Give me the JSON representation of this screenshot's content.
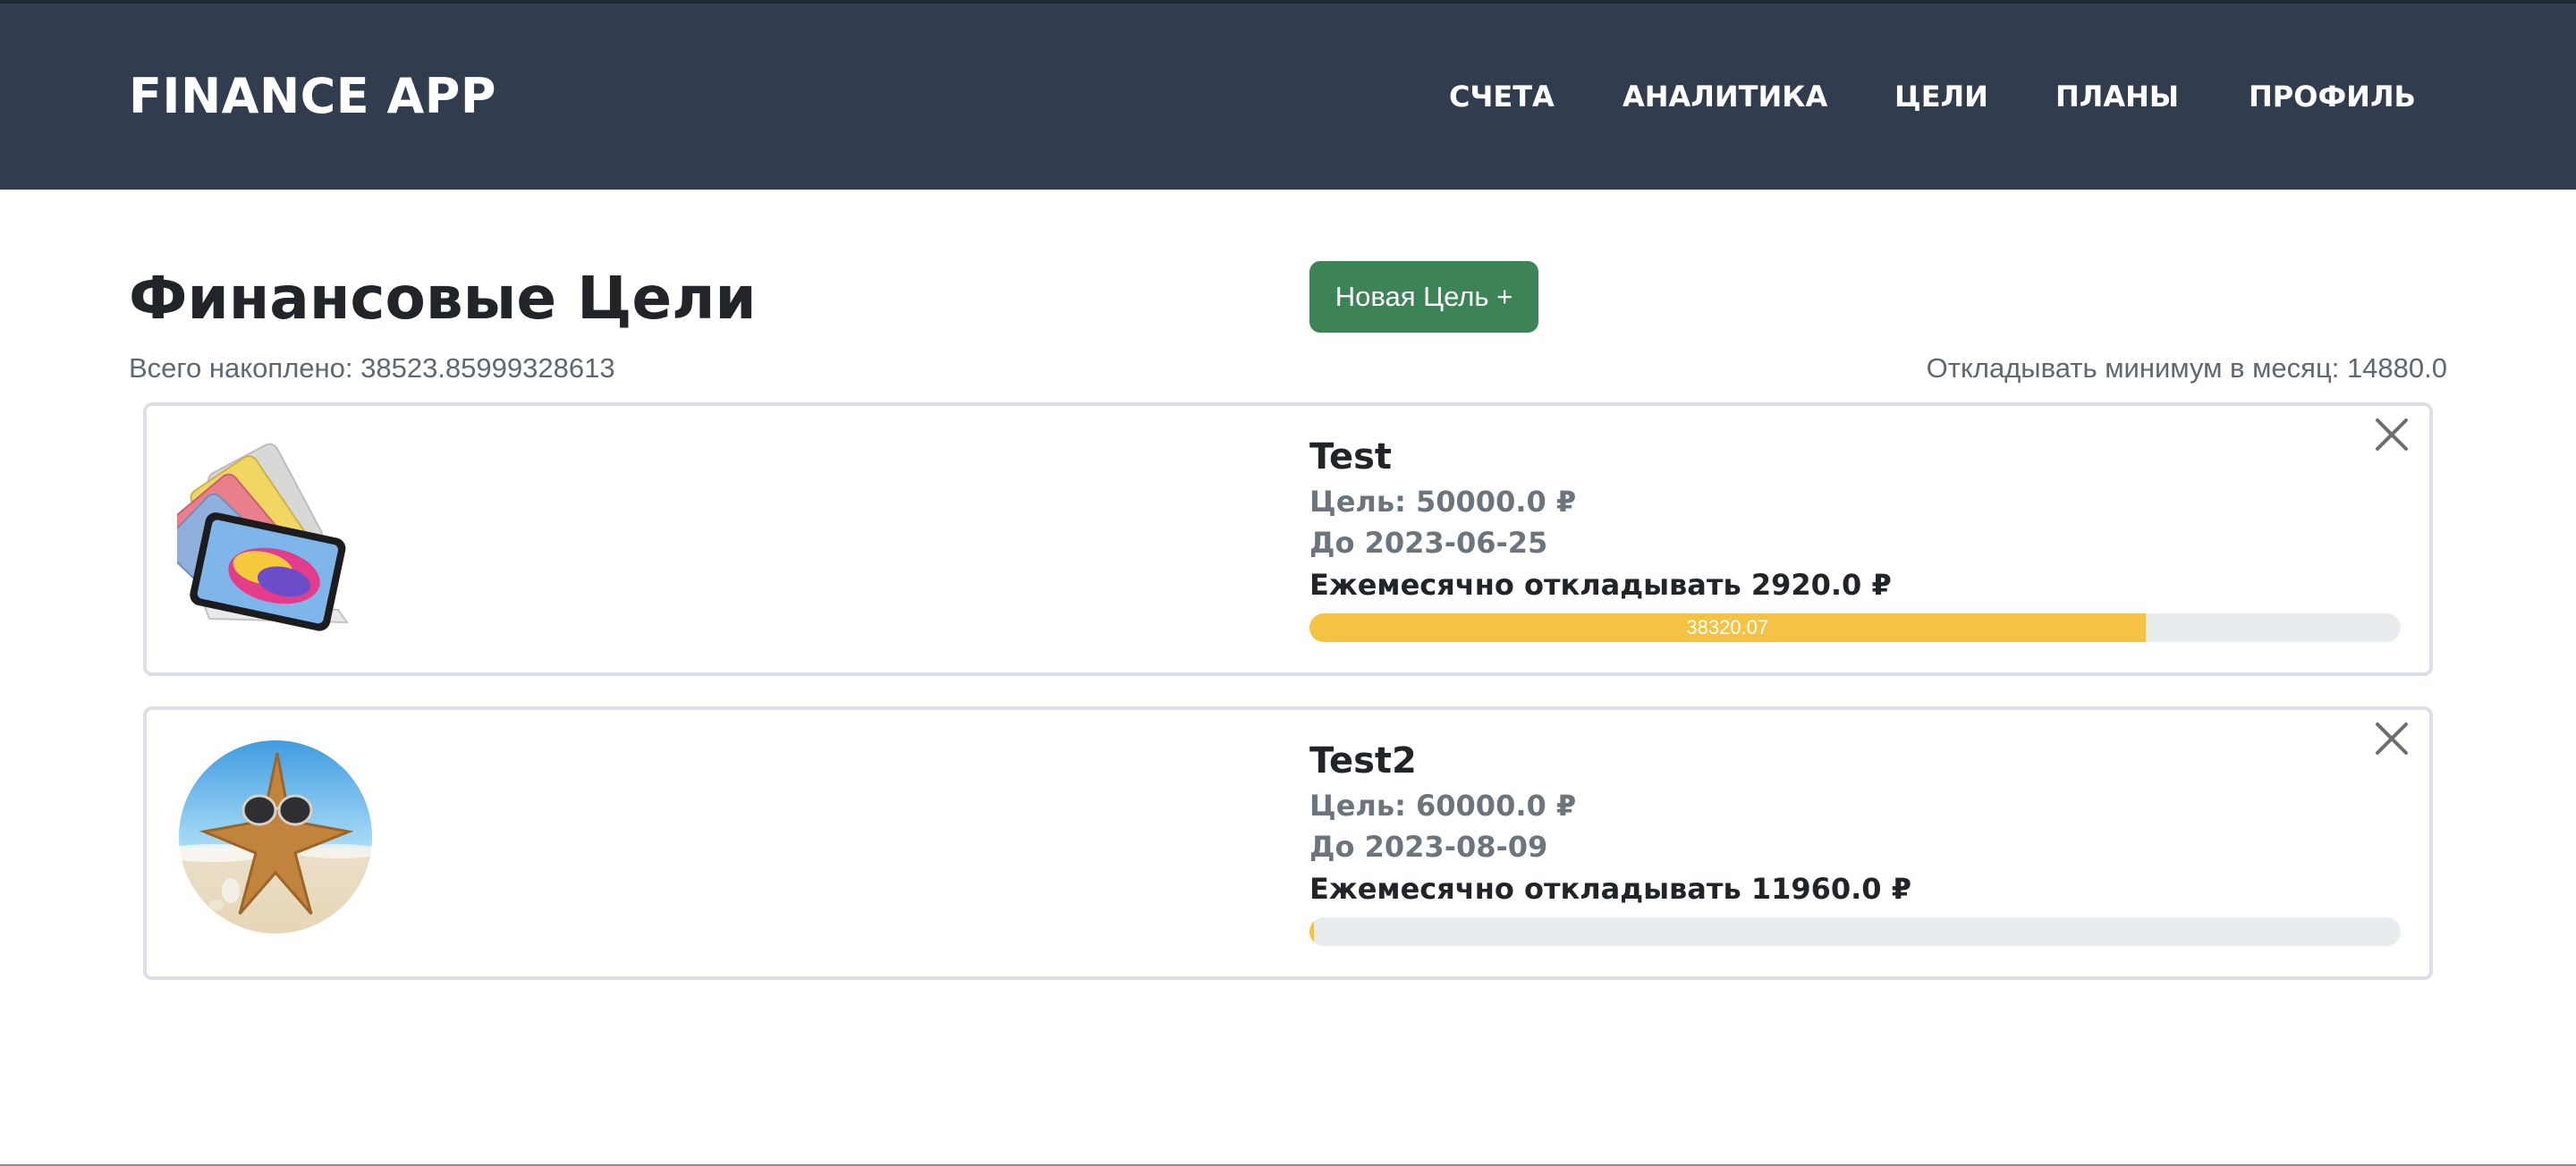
{
  "navbar": {
    "brand": "FINANCE APP",
    "links": [
      {
        "label": "СЧЕТА"
      },
      {
        "label": "АНАЛИТИКА"
      },
      {
        "label": "ЦЕЛИ"
      },
      {
        "label": "ПЛАНЫ"
      },
      {
        "label": "ПРОФИЛЬ"
      }
    ],
    "background": "#313c4f"
  },
  "page": {
    "title": "Финансовые Цели",
    "new_goal_button": "Новая Цель +",
    "total_saved": "Всего накоплено: 38523.85999328613",
    "min_monthly": "Откладывать минимум в месяц: 14880.0"
  },
  "goals": [
    {
      "title": "Test",
      "target": "Цель: 50000.0 ₽",
      "deadline": "До 2023-06-25",
      "monthly": "Ежемесячно откладывать 2920.0 ₽",
      "progress_label": "38320.07",
      "progress_fraction": 0.766,
      "image_icon": "tablet-image"
    },
    {
      "title": "Test2",
      "target": "Цель: 60000.0 ₽",
      "deadline": "До 2023-08-09",
      "monthly": "Ежемесячно откладывать 11960.0 ₽",
      "progress_label": "",
      "progress_fraction": 0.004,
      "image_icon": "starfish-beach-image"
    }
  ],
  "colors": {
    "accent_green": "#3c8456",
    "progress_yellow": "#f5c244",
    "muted_text": "#6c757d"
  }
}
